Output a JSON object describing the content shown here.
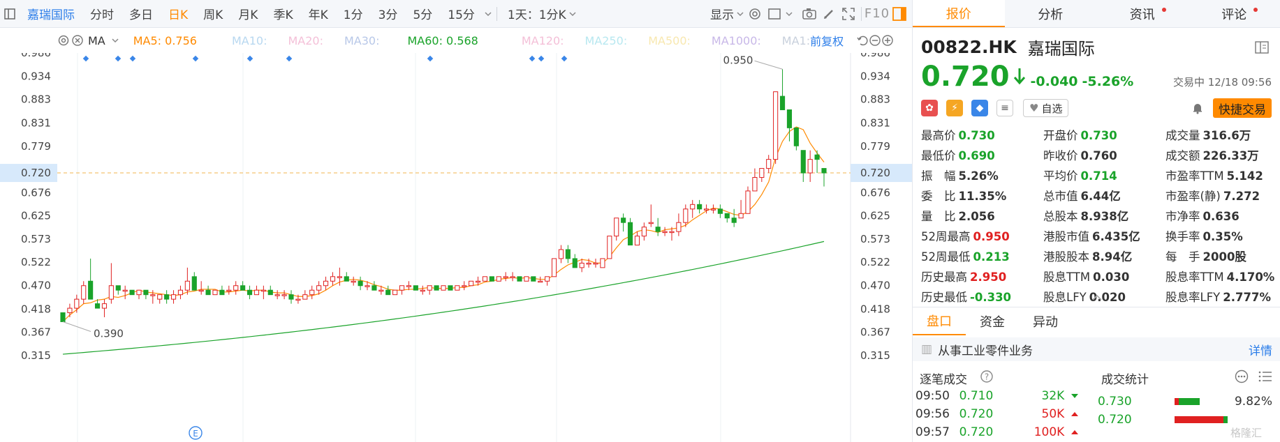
{
  "toolbar": {
    "stock_name": "嘉瑞国际",
    "periods": [
      "分时",
      "多日",
      "日K",
      "周K",
      "月K",
      "季K",
      "年K",
      "1分",
      "3分",
      "5分",
      "15分"
    ],
    "active_period": "日K",
    "period_select": "1天：1分K",
    "display_label": "显示"
  },
  "ma_bar": {
    "ma_label": "MA",
    "ma5": "MA5: 0.756",
    "ma10": "MA10:",
    "ma20": "MA20:",
    "ma30": "MA30:",
    "ma60": "MA60: 0.568",
    "ma120": "MA120:",
    "ma250": "MA250:",
    "ma500": "MA500:",
    "ma1000": "MA1000:",
    "ma1": "MA1:",
    "adjust": "前复权",
    "colors": {
      "ma5": "#ff8a00",
      "ma60": "#1aa32a",
      "faded": "#b8c8e8"
    }
  },
  "chart": {
    "y_ticks": [
      "0.986",
      "0.934",
      "0.883",
      "0.831",
      "0.779",
      "0.720",
      "0.676",
      "0.625",
      "0.573",
      "0.522",
      "0.470",
      "0.418",
      "0.367",
      "0.315"
    ],
    "current_price_label": "0.720",
    "high_label": "0.950",
    "low_label": "0.390",
    "marker_label": "E",
    "colors": {
      "up": "#e02020",
      "down": "#1aa32a",
      "ma5": "#ff8a00",
      "ma60": "#1aa32a"
    }
  },
  "chart_data": {
    "type": "candlestick",
    "ylim": [
      0.29,
      1.0
    ],
    "y_ticks": [
      0.986,
      0.934,
      0.883,
      0.831,
      0.779,
      0.72,
      0.676,
      0.625,
      0.573,
      0.522,
      0.47,
      0.418,
      0.367,
      0.315
    ],
    "last_price": 0.72,
    "annotations": [
      {
        "text": "0.950",
        "value": 0.95
      },
      {
        "text": "0.390",
        "value": 0.39
      }
    ],
    "ohlc": [
      [
        0.41,
        0.41,
        0.39,
        0.39
      ],
      [
        0.41,
        0.43,
        0.4,
        0.42
      ],
      [
        0.42,
        0.45,
        0.41,
        0.44
      ],
      [
        0.44,
        0.48,
        0.43,
        0.47
      ],
      [
        0.48,
        0.53,
        0.44,
        0.44
      ],
      [
        0.43,
        0.44,
        0.42,
        0.42
      ],
      [
        0.42,
        0.44,
        0.4,
        0.43
      ],
      [
        0.44,
        0.52,
        0.43,
        0.47
      ],
      [
        0.47,
        0.47,
        0.45,
        0.46
      ],
      [
        0.46,
        0.47,
        0.44,
        0.46
      ],
      [
        0.46,
        0.46,
        0.45,
        0.45
      ],
      [
        0.45,
        0.46,
        0.44,
        0.46
      ],
      [
        0.46,
        0.46,
        0.44,
        0.45
      ],
      [
        0.45,
        0.46,
        0.43,
        0.45
      ],
      [
        0.44,
        0.45,
        0.43,
        0.45
      ],
      [
        0.45,
        0.46,
        0.43,
        0.44
      ],
      [
        0.44,
        0.46,
        0.43,
        0.45
      ],
      [
        0.45,
        0.47,
        0.44,
        0.46
      ],
      [
        0.46,
        0.51,
        0.45,
        0.48
      ],
      [
        0.49,
        0.5,
        0.46,
        0.46
      ],
      [
        0.46,
        0.48,
        0.45,
        0.46
      ],
      [
        0.46,
        0.47,
        0.45,
        0.45
      ],
      [
        0.45,
        0.46,
        0.45,
        0.46
      ],
      [
        0.46,
        0.47,
        0.45,
        0.45
      ],
      [
        0.46,
        0.47,
        0.45,
        0.46
      ],
      [
        0.46,
        0.48,
        0.45,
        0.47
      ],
      [
        0.47,
        0.48,
        0.46,
        0.46
      ],
      [
        0.46,
        0.47,
        0.44,
        0.45
      ],
      [
        0.45,
        0.47,
        0.45,
        0.46
      ],
      [
        0.46,
        0.47,
        0.44,
        0.46
      ],
      [
        0.46,
        0.47,
        0.45,
        0.45
      ],
      [
        0.45,
        0.46,
        0.44,
        0.45
      ],
      [
        0.45,
        0.46,
        0.44,
        0.45
      ],
      [
        0.45,
        0.46,
        0.43,
        0.44
      ],
      [
        0.44,
        0.45,
        0.43,
        0.44
      ],
      [
        0.44,
        0.46,
        0.44,
        0.45
      ],
      [
        0.45,
        0.47,
        0.44,
        0.46
      ],
      [
        0.46,
        0.48,
        0.45,
        0.47
      ],
      [
        0.47,
        0.49,
        0.46,
        0.48
      ],
      [
        0.48,
        0.5,
        0.47,
        0.49
      ],
      [
        0.49,
        0.51,
        0.47,
        0.49
      ],
      [
        0.49,
        0.5,
        0.48,
        0.48
      ],
      [
        0.48,
        0.49,
        0.47,
        0.48
      ],
      [
        0.48,
        0.49,
        0.46,
        0.47
      ],
      [
        0.47,
        0.48,
        0.46,
        0.47
      ],
      [
        0.47,
        0.48,
        0.46,
        0.46
      ],
      [
        0.46,
        0.47,
        0.45,
        0.46
      ],
      [
        0.46,
        0.47,
        0.45,
        0.45
      ],
      [
        0.45,
        0.46,
        0.45,
        0.46
      ],
      [
        0.46,
        0.47,
        0.45,
        0.47
      ],
      [
        0.47,
        0.48,
        0.46,
        0.47
      ],
      [
        0.47,
        0.47,
        0.46,
        0.46
      ],
      [
        0.46,
        0.47,
        0.45,
        0.46
      ],
      [
        0.46,
        0.47,
        0.45,
        0.47
      ],
      [
        0.47,
        0.47,
        0.46,
        0.46
      ],
      [
        0.46,
        0.47,
        0.46,
        0.47
      ],
      [
        0.47,
        0.47,
        0.46,
        0.46
      ],
      [
        0.46,
        0.47,
        0.46,
        0.47
      ],
      [
        0.47,
        0.48,
        0.46,
        0.47
      ],
      [
        0.47,
        0.48,
        0.47,
        0.48
      ],
      [
        0.48,
        0.49,
        0.47,
        0.48
      ],
      [
        0.48,
        0.49,
        0.48,
        0.49
      ],
      [
        0.49,
        0.49,
        0.48,
        0.48
      ],
      [
        0.48,
        0.49,
        0.48,
        0.49
      ],
      [
        0.49,
        0.5,
        0.48,
        0.49
      ],
      [
        0.49,
        0.5,
        0.48,
        0.49
      ],
      [
        0.49,
        0.49,
        0.48,
        0.48
      ],
      [
        0.48,
        0.49,
        0.48,
        0.49
      ],
      [
        0.49,
        0.49,
        0.48,
        0.48
      ],
      [
        0.48,
        0.49,
        0.48,
        0.48
      ],
      [
        0.48,
        0.49,
        0.47,
        0.49
      ],
      [
        0.49,
        0.53,
        0.49,
        0.53
      ],
      [
        0.53,
        0.56,
        0.52,
        0.55
      ],
      [
        0.55,
        0.56,
        0.52,
        0.53
      ],
      [
        0.53,
        0.54,
        0.51,
        0.51
      ],
      [
        0.51,
        0.53,
        0.5,
        0.52
      ],
      [
        0.52,
        0.53,
        0.51,
        0.52
      ],
      [
        0.52,
        0.53,
        0.51,
        0.52
      ],
      [
        0.51,
        0.53,
        0.51,
        0.53
      ],
      [
        0.53,
        0.58,
        0.53,
        0.58
      ],
      [
        0.58,
        0.62,
        0.57,
        0.62
      ],
      [
        0.62,
        0.63,
        0.59,
        0.61
      ],
      [
        0.61,
        0.62,
        0.56,
        0.56
      ],
      [
        0.56,
        0.59,
        0.56,
        0.58
      ],
      [
        0.58,
        0.61,
        0.57,
        0.6
      ],
      [
        0.61,
        0.65,
        0.6,
        0.61
      ],
      [
        0.6,
        0.62,
        0.58,
        0.59
      ],
      [
        0.59,
        0.6,
        0.58,
        0.59
      ],
      [
        0.59,
        0.6,
        0.57,
        0.59
      ],
      [
        0.59,
        0.63,
        0.58,
        0.61
      ],
      [
        0.61,
        0.65,
        0.6,
        0.64
      ],
      [
        0.64,
        0.66,
        0.62,
        0.65
      ],
      [
        0.65,
        0.66,
        0.63,
        0.64
      ],
      [
        0.64,
        0.65,
        0.63,
        0.64
      ],
      [
        0.64,
        0.65,
        0.63,
        0.64
      ],
      [
        0.64,
        0.65,
        0.62,
        0.63
      ],
      [
        0.63,
        0.63,
        0.61,
        0.62
      ],
      [
        0.62,
        0.64,
        0.6,
        0.61
      ],
      [
        0.62,
        0.66,
        0.62,
        0.63
      ],
      [
        0.63,
        0.69,
        0.63,
        0.68
      ],
      [
        0.68,
        0.73,
        0.68,
        0.71
      ],
      [
        0.71,
        0.73,
        0.7,
        0.73
      ],
      [
        0.73,
        0.76,
        0.72,
        0.75
      ],
      [
        0.75,
        0.9,
        0.74,
        0.9
      ],
      [
        0.89,
        0.95,
        0.86,
        0.86
      ],
      [
        0.86,
        0.86,
        0.79,
        0.82
      ],
      [
        0.82,
        0.82,
        0.77,
        0.78
      ],
      [
        0.77,
        0.77,
        0.7,
        0.72
      ],
      [
        0.72,
        0.77,
        0.7,
        0.75
      ],
      [
        0.76,
        0.77,
        0.72,
        0.75
      ],
      [
        0.73,
        0.73,
        0.69,
        0.72
      ]
    ],
    "ma60_range": [
      0.318,
      0.568
    ],
    "series": [
      {
        "name": "MA5",
        "value": 0.756
      },
      {
        "name": "MA60",
        "value": 0.568
      }
    ]
  },
  "quote": {
    "tabs": [
      "报价",
      "分析",
      "资讯",
      "评论"
    ],
    "active_tab": "报价",
    "code": "00822.HK",
    "name": "嘉瑞国际",
    "price": "0.720",
    "change": "-0.040",
    "change_pct": "-5.26%",
    "status": "交易中 12/18 09:56",
    "watch": "自选",
    "fast_trade": "快捷交易",
    "stats": [
      {
        "label": "最高价",
        "value": "0.730",
        "color": "g"
      },
      {
        "label": "开盘价",
        "value": "0.730",
        "color": "g"
      },
      {
        "label": "成交量",
        "value": "316.6万",
        "color": ""
      },
      {
        "label": "最低价",
        "value": "0.690",
        "color": "g"
      },
      {
        "label": "昨收价",
        "value": "0.760",
        "color": ""
      },
      {
        "label": "成交额",
        "value": "226.33万",
        "color": ""
      },
      {
        "label": "振　幅",
        "value": "5.26%",
        "color": ""
      },
      {
        "label": "平均价",
        "value": "0.714",
        "color": "g"
      },
      {
        "label": "市盈率TTM",
        "value": "5.142",
        "color": ""
      },
      {
        "label": "委　比",
        "value": "11.35%",
        "color": ""
      },
      {
        "label": "总市值",
        "value": "6.44亿",
        "color": ""
      },
      {
        "label": "市盈率(静)",
        "value": "7.272",
        "color": ""
      },
      {
        "label": "量　比",
        "value": "2.056",
        "color": ""
      },
      {
        "label": "总股本",
        "value": "8.938亿",
        "color": ""
      },
      {
        "label": "市净率",
        "value": "0.636",
        "color": ""
      },
      {
        "label": "52周最高",
        "value": "0.950",
        "color": "r"
      },
      {
        "label": "港股市值",
        "value": "6.435亿",
        "color": ""
      },
      {
        "label": "换手率",
        "value": "0.35%",
        "color": ""
      },
      {
        "label": "52周最低",
        "value": "0.213",
        "color": "g"
      },
      {
        "label": "港股股本",
        "value": "8.94亿",
        "color": ""
      },
      {
        "label": "每　手",
        "value": "2000股",
        "color": ""
      },
      {
        "label": "历史最高",
        "value": "2.950",
        "color": "r"
      },
      {
        "label": "股息TTM",
        "value": "0.030",
        "color": ""
      },
      {
        "label": "股息率TTM",
        "value": "4.170%",
        "color": ""
      },
      {
        "label": "历史最低",
        "value": "-0.330",
        "color": "g"
      },
      {
        "label": "股息LFY",
        "value": "0.020",
        "color": ""
      },
      {
        "label": "股息率LFY",
        "value": "2.777%",
        "color": ""
      }
    ],
    "sub_tabs": [
      "盘口",
      "资金",
      "异动"
    ],
    "business": "从事工业零件业务",
    "detail": "详情",
    "trades_title": "逐笔成交",
    "summary_title": "成交统计",
    "trades": [
      {
        "time": "09:50",
        "price": "0.710",
        "vol": "32K",
        "dir": "down"
      },
      {
        "time": "09:56",
        "price": "0.720",
        "vol": "50K",
        "dir": "up"
      },
      {
        "time": "09:57",
        "price": "0.720",
        "vol": "100K",
        "dir": "up"
      }
    ],
    "summary": [
      {
        "price": "0.730",
        "pct": "9.82%",
        "share": 0.0982
      },
      {
        "price": "0.720",
        "pct": "",
        "share": 0.35
      }
    ],
    "watermark": "格隆汇"
  }
}
